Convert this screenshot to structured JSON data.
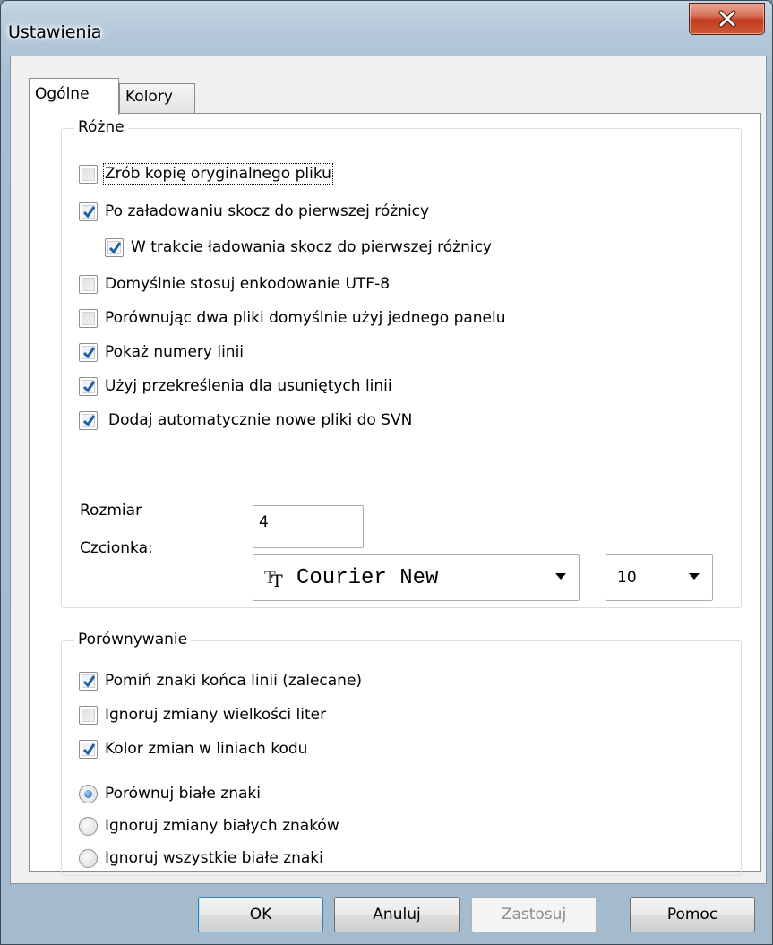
{
  "window": {
    "title": "Ustawienia"
  },
  "tabs": [
    {
      "label": "Ogólne",
      "active": true
    },
    {
      "label": "Kolory",
      "active": false
    }
  ],
  "group_rozne": {
    "legend": "Różne",
    "checkboxes": [
      {
        "label": "Zrób kopię oryginalnego pliku",
        "checked": false
      },
      {
        "label": "Po załadowaniu skocz do pierwszej różnicy",
        "checked": true
      },
      {
        "label": "W trakcie ładowania skocz do pierwszej różnicy",
        "checked": true
      },
      {
        "label": "Domyślnie stosuj enkodowanie UTF-8",
        "checked": false
      },
      {
        "label": "Porównując dwa pliki domyślnie użyj jednego panelu",
        "checked": false
      },
      {
        "label": "Pokaż numery linii",
        "checked": true
      },
      {
        "label": "Użyj przekreślenia dla usuniętych linii",
        "checked": true
      },
      {
        "label": "Dodaj automatycznie nowe pliki do SVN",
        "checked": true
      }
    ],
    "size_label": "Rozmiar",
    "size_value": "4",
    "font_label": "Czcionka:",
    "font_name": "Courier New",
    "font_size": "10"
  },
  "group_porownywanie": {
    "legend": "Porównywanie",
    "checkboxes": [
      {
        "label": "Pomiń znaki końca linii (zalecane)",
        "checked": true
      },
      {
        "label": "Ignoruj zmiany wielkości liter",
        "checked": false
      },
      {
        "label": "Kolor zmian w liniach kodu",
        "checked": true
      }
    ],
    "radios": [
      {
        "label": "Porównuj białe znaki",
        "checked": true
      },
      {
        "label": "Ignoruj zmiany białych znaków",
        "checked": false
      },
      {
        "label": "Ignoruj wszystkie białe znaki",
        "checked": false
      }
    ]
  },
  "buttons": {
    "ok": "OK",
    "cancel": "Anuluj",
    "apply": "Zastosuj",
    "help": "Pomoc"
  },
  "icons": {
    "close": "close-icon",
    "font": "truetype-font-icon",
    "dropdown": "chevron-down-icon"
  },
  "colors": {
    "close_button": "#c13b1f",
    "check_mark": "#1f5fa8",
    "default_button_border": "#3c7fb1"
  }
}
